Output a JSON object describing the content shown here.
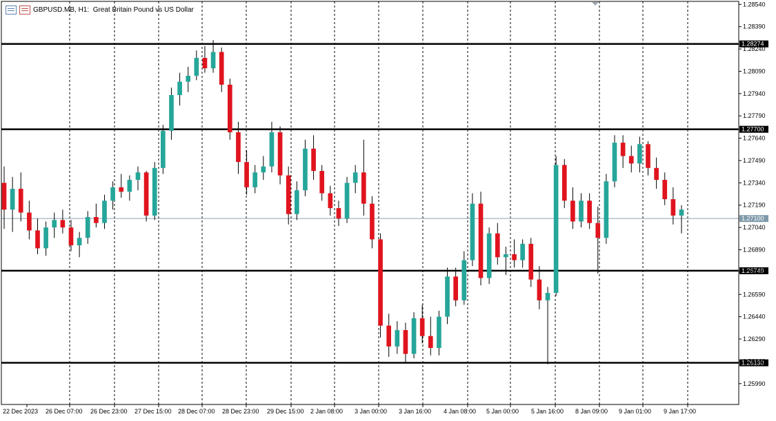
{
  "header": {
    "symbol": "GBPUSD.MB",
    "timeframe": "H1:",
    "description": "Great Britain Pound vs US Dollar",
    "icons": [
      "window-list-icon",
      "chart-settings-icon"
    ]
  },
  "colors": {
    "bull": "#26a69a",
    "bear": "#e0141e",
    "wick": "#000000",
    "grid": "#000000",
    "level": "#000000",
    "price_line": "#8aa0b0",
    "label_bg": "#000000",
    "label_fg": "#ffffff",
    "current_bg": "#7f9aaa"
  },
  "chart_data": {
    "type": "candlestick",
    "title": "GBPUSD.MB, H1: Great Britan Pound vs US Dollar",
    "ylim": [
      1.2585,
      1.2856
    ],
    "y_ticks": [
      "1.28540",
      "1.28390",
      "1.28240",
      "1.28090",
      "1.27940",
      "1.27790",
      "1.27640",
      "1.27490",
      "1.27340",
      "1.27190",
      "1.27040",
      "1.26890",
      "1.26740",
      "1.26590",
      "1.26440",
      "1.26290",
      "1.26140",
      "1.25990"
    ],
    "x_ticks": [
      "22 Dec 2023",
      "26 Dec 07:00",
      "26 Dec 23:00",
      "27 Dec 15:00",
      "28 Dec 07:00",
      "28 Dec 23:00",
      "29 Dec 15:00",
      "2 Jan 08:00",
      "3 Jan 00:00",
      "3 Jan 16:00",
      "4 Jan 08:00",
      "5 Jan 00:00",
      "5 Jan 16:00",
      "8 Jan 09:00",
      "9 Jan 01:00",
      "9 Jan 17:00"
    ],
    "horizontal_levels": [
      "1.28274",
      "1.27700",
      "1.26749",
      "1.26130"
    ],
    "current_price": "1.27100",
    "grid": "vertical-dashed",
    "candles": [
      {
        "o": 1.2734,
        "h": 1.2745,
        "l": 1.2703,
        "c": 1.2716
      },
      {
        "o": 1.2716,
        "h": 1.2738,
        "l": 1.2701,
        "c": 1.273
      },
      {
        "o": 1.273,
        "h": 1.2741,
        "l": 1.2708,
        "c": 1.2714
      },
      {
        "o": 1.2714,
        "h": 1.2722,
        "l": 1.2696,
        "c": 1.2702
      },
      {
        "o": 1.2702,
        "h": 1.271,
        "l": 1.2686,
        "c": 1.269
      },
      {
        "o": 1.269,
        "h": 1.2708,
        "l": 1.2685,
        "c": 1.2704
      },
      {
        "o": 1.2704,
        "h": 1.2714,
        "l": 1.2697,
        "c": 1.2709
      },
      {
        "o": 1.2709,
        "h": 1.2716,
        "l": 1.27,
        "c": 1.2704
      },
      {
        "o": 1.2704,
        "h": 1.2709,
        "l": 1.2688,
        "c": 1.2692
      },
      {
        "o": 1.2692,
        "h": 1.2701,
        "l": 1.2684,
        "c": 1.2697
      },
      {
        "o": 1.2697,
        "h": 1.2715,
        "l": 1.2693,
        "c": 1.2711
      },
      {
        "o": 1.2711,
        "h": 1.272,
        "l": 1.2704,
        "c": 1.2707
      },
      {
        "o": 1.2707,
        "h": 1.2726,
        "l": 1.2703,
        "c": 1.2722
      },
      {
        "o": 1.2722,
        "h": 1.2735,
        "l": 1.2716,
        "c": 1.2731
      },
      {
        "o": 1.2731,
        "h": 1.274,
        "l": 1.2724,
        "c": 1.2728
      },
      {
        "o": 1.2728,
        "h": 1.2739,
        "l": 1.2722,
        "c": 1.2736
      },
      {
        "o": 1.2736,
        "h": 1.2745,
        "l": 1.2729,
        "c": 1.2741
      },
      {
        "o": 1.2741,
        "h": 1.2742,
        "l": 1.2708,
        "c": 1.2712
      },
      {
        "o": 1.2712,
        "h": 1.2748,
        "l": 1.2709,
        "c": 1.2744
      },
      {
        "o": 1.2744,
        "h": 1.2773,
        "l": 1.274,
        "c": 1.2769
      },
      {
        "o": 1.2769,
        "h": 1.2798,
        "l": 1.2763,
        "c": 1.2793
      },
      {
        "o": 1.2793,
        "h": 1.2808,
        "l": 1.2786,
        "c": 1.2802
      },
      {
        "o": 1.2802,
        "h": 1.2812,
        "l": 1.2795,
        "c": 1.2806
      },
      {
        "o": 1.2806,
        "h": 1.2823,
        "l": 1.2803,
        "c": 1.2818
      },
      {
        "o": 1.2818,
        "h": 1.2826,
        "l": 1.2808,
        "c": 1.2811
      },
      {
        "o": 1.2811,
        "h": 1.283,
        "l": 1.2808,
        "c": 1.2822
      },
      {
        "o": 1.2822,
        "h": 1.2825,
        "l": 1.2795,
        "c": 1.28
      },
      {
        "o": 1.28,
        "h": 1.2804,
        "l": 1.2763,
        "c": 1.2768
      },
      {
        "o": 1.2768,
        "h": 1.2775,
        "l": 1.274,
        "c": 1.2748
      },
      {
        "o": 1.2748,
        "h": 1.2756,
        "l": 1.2726,
        "c": 1.2731
      },
      {
        "o": 1.2731,
        "h": 1.2746,
        "l": 1.2727,
        "c": 1.2741
      },
      {
        "o": 1.2741,
        "h": 1.2752,
        "l": 1.2736,
        "c": 1.2745
      },
      {
        "o": 1.2745,
        "h": 1.2775,
        "l": 1.2741,
        "c": 1.2768
      },
      {
        "o": 1.2768,
        "h": 1.2772,
        "l": 1.2733,
        "c": 1.2739
      },
      {
        "o": 1.2739,
        "h": 1.2745,
        "l": 1.2706,
        "c": 1.2713
      },
      {
        "o": 1.2713,
        "h": 1.2735,
        "l": 1.2709,
        "c": 1.2729
      },
      {
        "o": 1.2729,
        "h": 1.2763,
        "l": 1.2725,
        "c": 1.2757
      },
      {
        "o": 1.2757,
        "h": 1.2766,
        "l": 1.2736,
        "c": 1.2742
      },
      {
        "o": 1.2742,
        "h": 1.2746,
        "l": 1.2722,
        "c": 1.2727
      },
      {
        "o": 1.2727,
        "h": 1.2732,
        "l": 1.2712,
        "c": 1.2717
      },
      {
        "o": 1.2717,
        "h": 1.2722,
        "l": 1.2705,
        "c": 1.271
      },
      {
        "o": 1.271,
        "h": 1.2738,
        "l": 1.2707,
        "c": 1.2734
      },
      {
        "o": 1.2734,
        "h": 1.2746,
        "l": 1.2727,
        "c": 1.2741
      },
      {
        "o": 1.2741,
        "h": 1.2763,
        "l": 1.2712,
        "c": 1.272
      },
      {
        "o": 1.272,
        "h": 1.2725,
        "l": 1.269,
        "c": 1.2696
      },
      {
        "o": 1.2696,
        "h": 1.27,
        "l": 1.263,
        "c": 1.2638
      },
      {
        "o": 1.2638,
        "h": 1.2646,
        "l": 1.2617,
        "c": 1.2624
      },
      {
        "o": 1.2624,
        "h": 1.2641,
        "l": 1.2619,
        "c": 1.2635
      },
      {
        "o": 1.2635,
        "h": 1.264,
        "l": 1.2613,
        "c": 1.2619
      },
      {
        "o": 1.2619,
        "h": 1.2647,
        "l": 1.2616,
        "c": 1.2643
      },
      {
        "o": 1.2643,
        "h": 1.2652,
        "l": 1.2626,
        "c": 1.2631
      },
      {
        "o": 1.2631,
        "h": 1.2644,
        "l": 1.2618,
        "c": 1.2623
      },
      {
        "o": 1.2623,
        "h": 1.2648,
        "l": 1.2618,
        "c": 1.2644
      },
      {
        "o": 1.2644,
        "h": 1.2677,
        "l": 1.2639,
        "c": 1.2671
      },
      {
        "o": 1.2671,
        "h": 1.2677,
        "l": 1.2651,
        "c": 1.2655
      },
      {
        "o": 1.2655,
        "h": 1.2688,
        "l": 1.2652,
        "c": 1.2682
      },
      {
        "o": 1.2682,
        "h": 1.2727,
        "l": 1.2678,
        "c": 1.272
      },
      {
        "o": 1.272,
        "h": 1.2728,
        "l": 1.2665,
        "c": 1.267
      },
      {
        "o": 1.267,
        "h": 1.2704,
        "l": 1.2666,
        "c": 1.27
      },
      {
        "o": 1.27,
        "h": 1.2707,
        "l": 1.2679,
        "c": 1.2684
      },
      {
        "o": 1.2684,
        "h": 1.2691,
        "l": 1.2672,
        "c": 1.2686
      },
      {
        "o": 1.2686,
        "h": 1.2696,
        "l": 1.2677,
        "c": 1.2682
      },
      {
        "o": 1.2682,
        "h": 1.2696,
        "l": 1.2677,
        "c": 1.2693
      },
      {
        "o": 1.2693,
        "h": 1.2697,
        "l": 1.2664,
        "c": 1.2669
      },
      {
        "o": 1.2669,
        "h": 1.2678,
        "l": 1.2649,
        "c": 1.2655
      },
      {
        "o": 1.2655,
        "h": 1.2664,
        "l": 1.2612,
        "c": 1.266
      },
      {
        "o": 1.266,
        "h": 1.2752,
        "l": 1.2658,
        "c": 1.2746
      },
      {
        "o": 1.2746,
        "h": 1.275,
        "l": 1.2717,
        "c": 1.2722
      },
      {
        "o": 1.2722,
        "h": 1.2731,
        "l": 1.2703,
        "c": 1.2708
      },
      {
        "o": 1.2708,
        "h": 1.2727,
        "l": 1.2704,
        "c": 1.2722
      },
      {
        "o": 1.2722,
        "h": 1.2727,
        "l": 1.2703,
        "c": 1.2707
      },
      {
        "o": 1.2707,
        "h": 1.2718,
        "l": 1.2673,
        "c": 1.2697
      },
      {
        "o": 1.2697,
        "h": 1.274,
        "l": 1.2693,
        "c": 1.2735
      },
      {
        "o": 1.2735,
        "h": 1.2766,
        "l": 1.2731,
        "c": 1.2761
      },
      {
        "o": 1.2761,
        "h": 1.2766,
        "l": 1.2744,
        "c": 1.2752
      },
      {
        "o": 1.2752,
        "h": 1.2759,
        "l": 1.2741,
        "c": 1.2747
      },
      {
        "o": 1.2747,
        "h": 1.2765,
        "l": 1.2741,
        "c": 1.276
      },
      {
        "o": 1.276,
        "h": 1.2762,
        "l": 1.2739,
        "c": 1.2744
      },
      {
        "o": 1.2744,
        "h": 1.2751,
        "l": 1.273,
        "c": 1.2736
      },
      {
        "o": 1.2736,
        "h": 1.2741,
        "l": 1.2719,
        "c": 1.2723
      },
      {
        "o": 1.2723,
        "h": 1.2731,
        "l": 1.2706,
        "c": 1.2712
      },
      {
        "o": 1.2712,
        "h": 1.2719,
        "l": 1.27,
        "c": 1.2716
      }
    ]
  }
}
